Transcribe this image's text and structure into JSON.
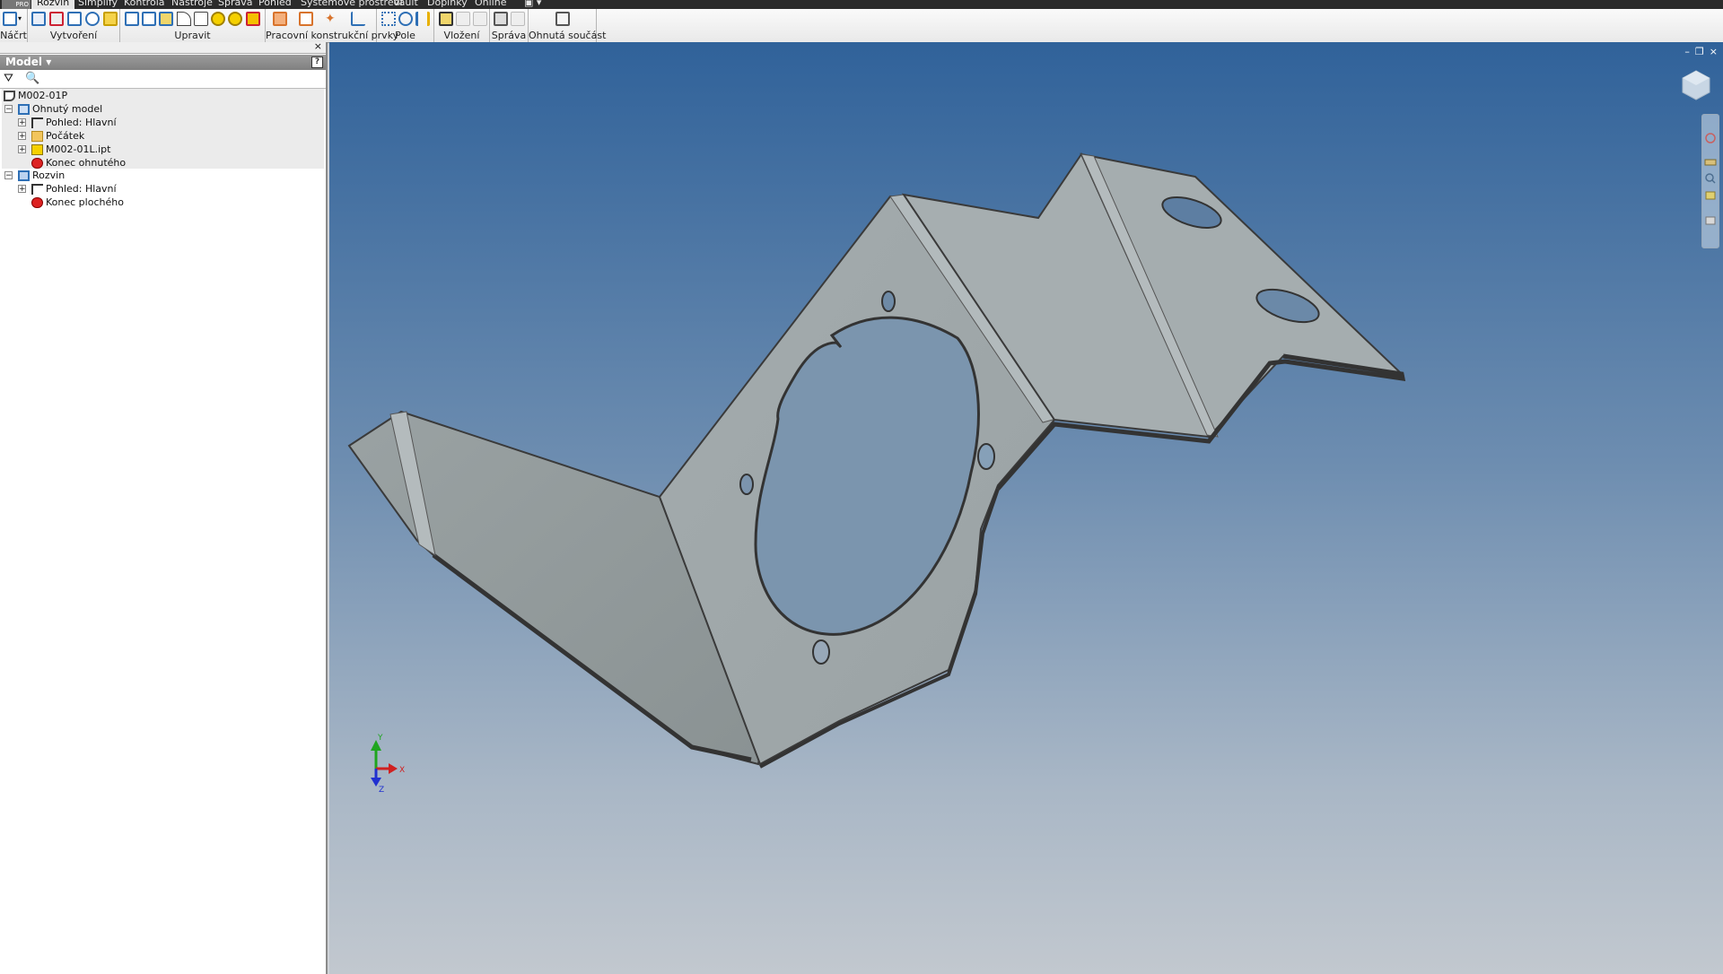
{
  "menu_tabs": [
    "Rozvin",
    "Simplify",
    "Kontrola",
    "Nástroje",
    "Správa",
    "Pohled",
    "Systémové prostředí",
    "Vault",
    "Doplňky",
    "Online"
  ],
  "logo_text": "PRO",
  "ribbon_groups": [
    "Náčrt",
    "Vytvoření",
    "Upravit",
    "Pracovní konstrukční prvky",
    "Pole",
    "Vložení",
    "Správa",
    "Ohnutá součást"
  ],
  "browser": {
    "title": "Model",
    "tree": {
      "root": "M002-01P",
      "bent_model": "Ohnutý model",
      "view_main_1": "Pohled: Hlavní",
      "origin": "Počátek",
      "part_file": "M002-01L.ipt",
      "end_bent": "Konec ohnutého",
      "flat": "Rozvin",
      "view_main_2": "Pohled: Hlavní",
      "end_flat": "Konec plochého"
    }
  },
  "triad": {
    "x": "X",
    "y": "Y",
    "z": "Z"
  },
  "colors": {
    "viewport_top": "#30629a",
    "viewport_bottom": "#c2c8cf",
    "part": "#a7aeb0"
  }
}
